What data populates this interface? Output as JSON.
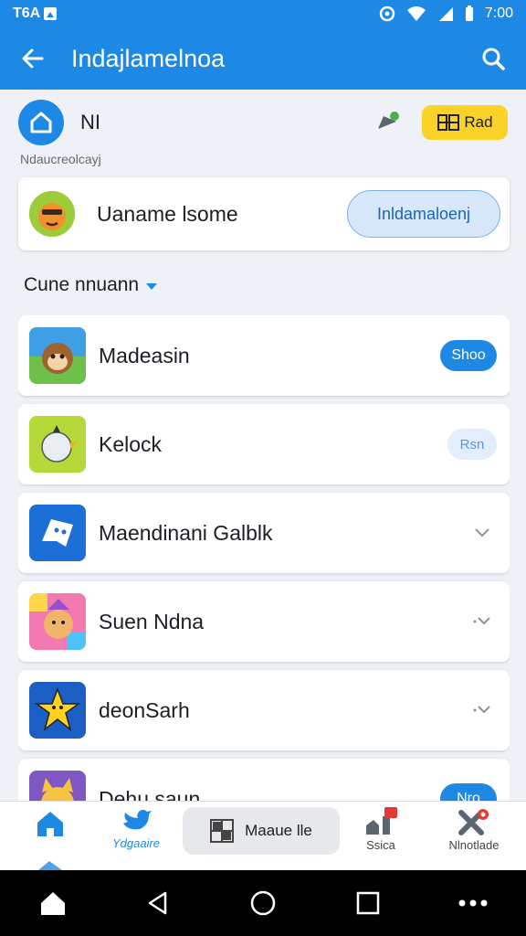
{
  "status_bar": {
    "left_text": "T6A",
    "time": "7:00"
  },
  "app_bar": {
    "title": "Indajlamelnoa"
  },
  "profile": {
    "name": "NI",
    "subtitle": "Ndaucreolcayj",
    "action_label": "Rad"
  },
  "featured": {
    "name": "Uaname lsome",
    "button_label": "Inldamaloenj"
  },
  "section": {
    "title": "Cune nnuann"
  },
  "list": {
    "items": [
      {
        "label": "Madeasin",
        "action": "Shoo",
        "action_style": "solid"
      },
      {
        "label": "Kelock",
        "action": "Rsn",
        "action_style": "light"
      },
      {
        "label": "Maendinani Galblk",
        "action": "",
        "action_style": "chevron"
      },
      {
        "label": "Suen Ndna",
        "action": "",
        "action_style": "chevron"
      },
      {
        "label": "deonSarh",
        "action": "",
        "action_style": "chevron"
      },
      {
        "label": "Dehu saun",
        "action": "Nro",
        "action_style": "solid"
      }
    ]
  },
  "bottom_nav": {
    "home_label": "",
    "second_label": "Ydgaaire",
    "center_label": "Maaue lle",
    "fourth_label": "Ssica",
    "fifth_label": "Nlnotlade"
  },
  "colors": {
    "primary": "#1e88e5",
    "accent_yellow": "#fbd227",
    "background": "#eef1f5"
  }
}
